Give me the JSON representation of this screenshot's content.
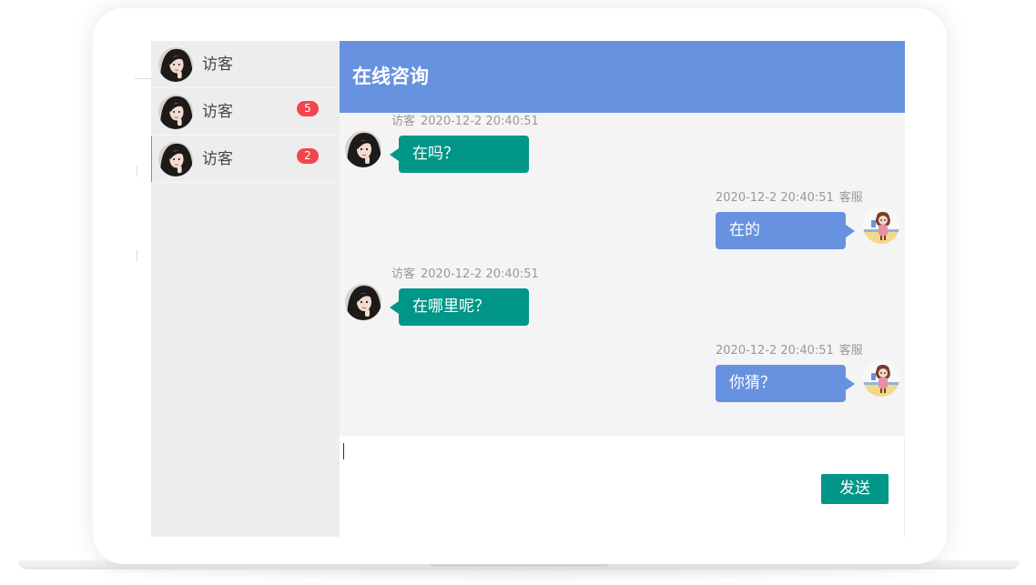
{
  "sidebar": {
    "items": [
      {
        "name": "访客",
        "badge": ""
      },
      {
        "name": "访客",
        "badge": "5"
      },
      {
        "name": "访客",
        "badge": "2"
      }
    ]
  },
  "chat": {
    "title": "在线咨询",
    "messages": [
      {
        "side": "left",
        "sender": "访客",
        "time": "2020-12-2 20:40:51",
        "text": "在吗？"
      },
      {
        "side": "right",
        "sender": "客服",
        "time": "2020-12-2 20:40:51",
        "text": "在的"
      },
      {
        "side": "left",
        "sender": "访客",
        "time": "2020-12-2 20:40:51",
        "text": "在哪里呢？"
      },
      {
        "side": "right",
        "sender": "客服",
        "time": "2020-12-2 20:40:51",
        "text": "你猜？"
      }
    ],
    "input": {
      "value": "",
      "placeholder": ""
    },
    "send_label": "发送"
  },
  "colors": {
    "header": "#6792e0",
    "visitor_bubble": "#009688",
    "agent_bubble": "#6792e0",
    "badge": "#f2454c",
    "send_button": "#009688"
  },
  "icons": {
    "visitor_avatar": "visitor-avatar-icon",
    "agent_avatar": "agent-avatar-icon"
  }
}
